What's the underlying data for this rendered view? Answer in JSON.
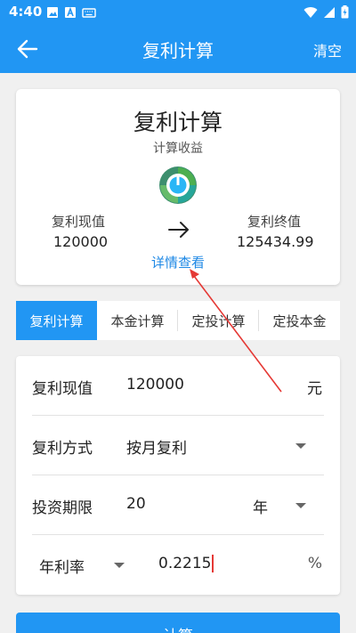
{
  "status_bar": {
    "time": "4:40"
  },
  "app_bar": {
    "title": "复利计算",
    "clear_label": "清空"
  },
  "summary": {
    "title": "复利计算",
    "subtitle": "计算收益",
    "present_value_label": "复利现值",
    "present_value": "120000",
    "future_value_label": "复利终值",
    "future_value": "125434.99",
    "details_link": "详情查看"
  },
  "tabs": [
    {
      "label": "复利计算",
      "active": true
    },
    {
      "label": "本金计算",
      "active": false
    },
    {
      "label": "定投计算",
      "active": false
    },
    {
      "label": "定投本金",
      "active": false
    }
  ],
  "form": {
    "present_value": {
      "label": "复利现值",
      "value": "120000",
      "unit": "元"
    },
    "compound_method": {
      "label": "复利方式",
      "value": "按月复利"
    },
    "period": {
      "label": "投资期限",
      "value": "20",
      "unit": "年"
    },
    "rate": {
      "label": "年利率",
      "value": "0.2215",
      "unit": "%"
    }
  },
  "calculate_label": "计算",
  "colors": {
    "primary": "#2196f3",
    "annotation": "#e53935"
  }
}
